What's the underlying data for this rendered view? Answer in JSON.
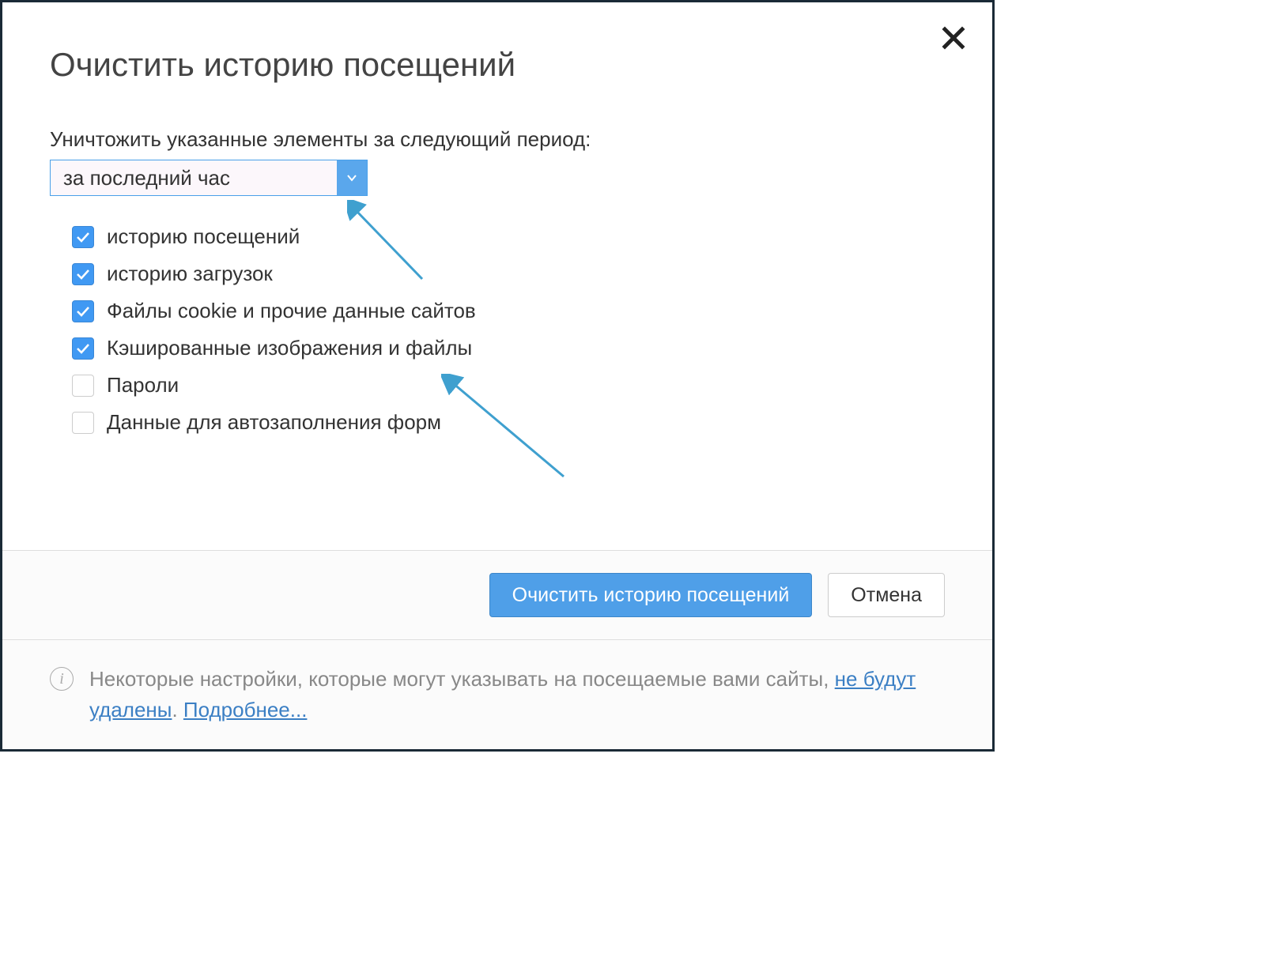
{
  "dialog": {
    "title": "Очистить историю посещений",
    "period_label": "Уничтожить указанные элементы за следующий период:",
    "select_value": "за последний час",
    "options": [
      {
        "label": "историю посещений",
        "checked": true
      },
      {
        "label": "историю загрузок",
        "checked": true
      },
      {
        "label": "Файлы cookie и прочие данные сайтов",
        "checked": true
      },
      {
        "label": "Кэшированные изображения и файлы",
        "checked": true
      },
      {
        "label": "Пароли",
        "checked": false
      },
      {
        "label": "Данные для автозаполнения форм",
        "checked": false
      }
    ],
    "primary_button": "Очистить историю посещений",
    "cancel_button": "Отмена",
    "info_text_1": "Некоторые настройки, которые могут указывать на посещаемые вами сайты, ",
    "info_link_1": "не будут удалены",
    "info_sep": ". ",
    "info_link_2": "Подробнее..."
  }
}
